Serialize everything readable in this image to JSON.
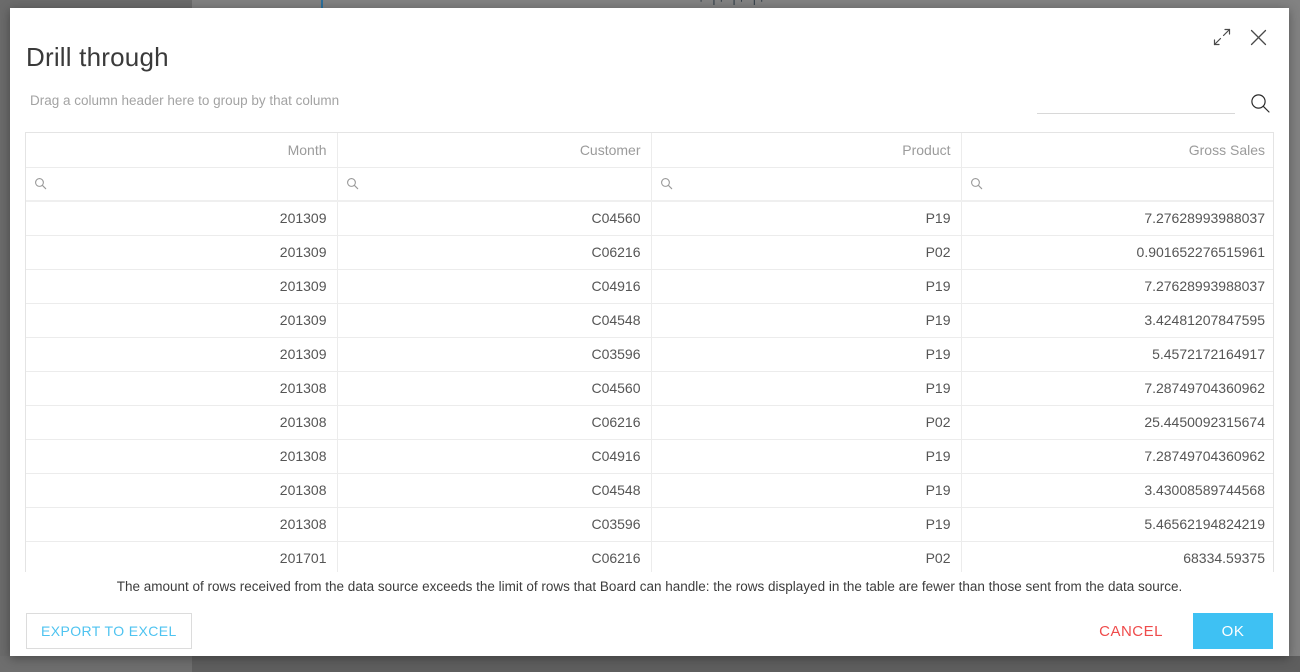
{
  "dialog": {
    "title": "Drill through",
    "group_hint": "Drag a column header here to group by that column",
    "expand_icon": "expand-diagonal-icon",
    "close_icon": "close-icon"
  },
  "search": {
    "value": "",
    "placeholder": "",
    "icon": "search-icon"
  },
  "grid": {
    "columns": [
      {
        "key": "month",
        "label": "Month",
        "filter_icon": "search-icon",
        "filter_value": ""
      },
      {
        "key": "customer",
        "label": "Customer",
        "filter_icon": "search-icon",
        "filter_value": ""
      },
      {
        "key": "product",
        "label": "Product",
        "filter_icon": "search-icon",
        "filter_value": ""
      },
      {
        "key": "gross",
        "label": "Gross Sales",
        "filter_icon": "search-icon",
        "filter_value": ""
      }
    ],
    "rows": [
      [
        "201309",
        "C04560",
        "P19",
        "7.27628993988037"
      ],
      [
        "201309",
        "C06216",
        "P02",
        "0.901652276515961"
      ],
      [
        "201309",
        "C04916",
        "P19",
        "7.27628993988037"
      ],
      [
        "201309",
        "C04548",
        "P19",
        "3.42481207847595"
      ],
      [
        "201309",
        "C03596",
        "P19",
        "5.4572172164917"
      ],
      [
        "201308",
        "C04560",
        "P19",
        "7.28749704360962"
      ],
      [
        "201308",
        "C06216",
        "P02",
        "25.4450092315674"
      ],
      [
        "201308",
        "C04916",
        "P19",
        "7.28749704360962"
      ],
      [
        "201308",
        "C04548",
        "P19",
        "3.43008589744568"
      ],
      [
        "201308",
        "C03596",
        "P19",
        "5.46562194824219"
      ],
      [
        "201701",
        "C06216",
        "P02",
        "68334.59375"
      ]
    ]
  },
  "footer": {
    "warning": "The amount of rows received from the data source exceeds the limit of rows that Board can handle: the rows displayed in the table are fewer than those sent from the data source.",
    "export_label": "EXPORT TO EXCEL",
    "cancel_label": "CANCEL",
    "ok_label": "OK"
  },
  "colors": {
    "accent_blue": "#3ec1f3",
    "export_blue": "#4ec3f0",
    "cancel_red": "#ef4b4b",
    "backdrop": "#5f5f5f",
    "dialog_bg": "#ffffff",
    "header_text": "#9b9b9b",
    "cell_text": "#555555",
    "grid_line": "#ececec"
  },
  "background": {
    "top_fragments": "⌐  |  ⌐ |  ⌐  |  ⌐"
  }
}
